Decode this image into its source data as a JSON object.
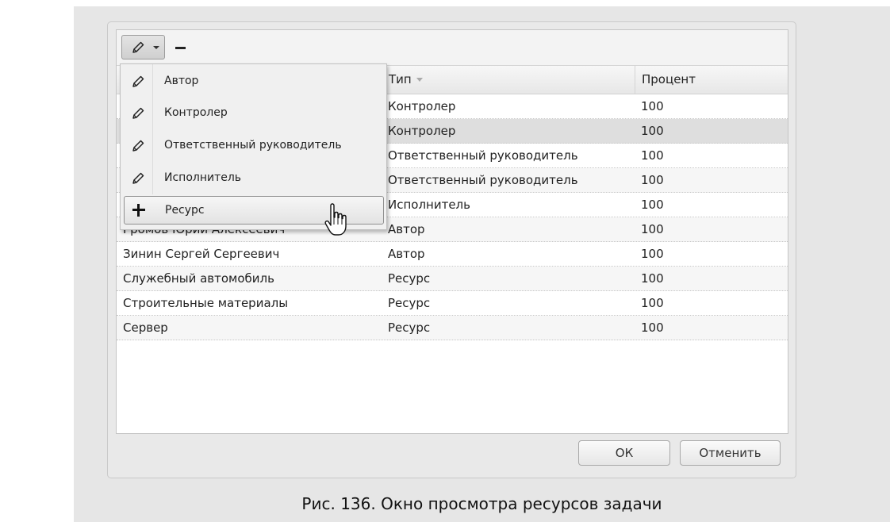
{
  "toolbar": {
    "edit_icon": "pencil-icon",
    "dropdown_icon": "caret-down-icon",
    "remove_icon": "minus-icon"
  },
  "grid": {
    "columns": [
      "",
      "Тип",
      "Процент"
    ],
    "sort_icon": "sort-desc-icon",
    "rows": [
      {
        "name": "",
        "type": "Контролер",
        "percent": "100"
      },
      {
        "name": "",
        "type": "Контролер",
        "percent": "100"
      },
      {
        "name": "",
        "type": "Ответственный руководитель",
        "percent": "100"
      },
      {
        "name": "",
        "type": "Ответственный руководитель",
        "percent": "100"
      },
      {
        "name": "",
        "type": "Исполнитель",
        "percent": "100"
      },
      {
        "name": "Громов Юрий Алексеевич",
        "type": "Автор",
        "percent": "100"
      },
      {
        "name": "Зинин Сергей Сергеевич",
        "type": "Автор",
        "percent": "100"
      },
      {
        "name": "Служебный автомобиль",
        "type": "Ресурс",
        "percent": "100"
      },
      {
        "name": "Строительные материалы",
        "type": "Ресурс",
        "percent": "100"
      },
      {
        "name": "Сервер",
        "type": "Ресурс",
        "percent": "100"
      }
    ]
  },
  "menu": {
    "items": [
      {
        "label": "Автор",
        "icon": "pencil-icon"
      },
      {
        "label": "Контролер",
        "icon": "pencil-icon"
      },
      {
        "label": "Ответственный руководитель",
        "icon": "pencil-icon"
      },
      {
        "label": "Исполнитель",
        "icon": "pencil-icon"
      },
      {
        "label": "Ресурс",
        "icon": "plus-icon"
      }
    ]
  },
  "buttons": {
    "ok": "ОК",
    "cancel": "Отменить"
  },
  "caption": "Рис. 136. Окно просмотра ресурсов задачи"
}
